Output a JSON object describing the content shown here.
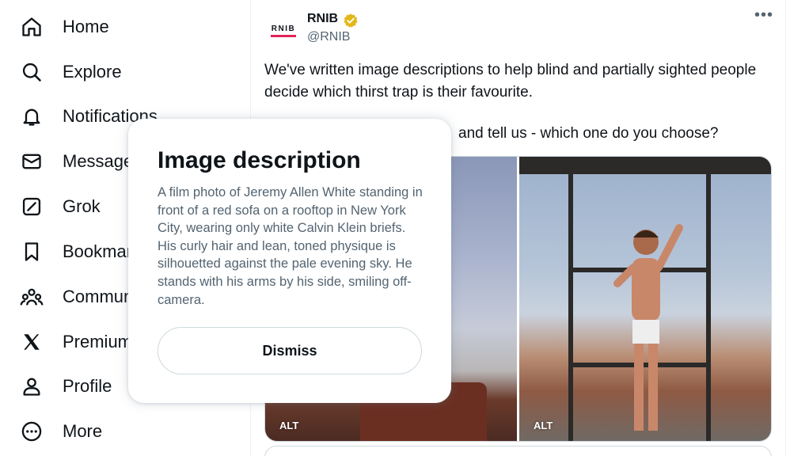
{
  "sidebar": {
    "items": [
      {
        "label": "Home",
        "icon": "home-icon"
      },
      {
        "label": "Explore",
        "icon": "search-icon"
      },
      {
        "label": "Notifications",
        "icon": "bell-icon"
      },
      {
        "label": "Messages",
        "icon": "envelope-icon"
      },
      {
        "label": "Grok",
        "icon": "grok-icon"
      },
      {
        "label": "Bookmarks",
        "icon": "bookmark-icon"
      },
      {
        "label": "Communities",
        "icon": "communities-icon"
      },
      {
        "label": "Premium",
        "icon": "x-logo-icon"
      },
      {
        "label": "Profile",
        "icon": "person-icon"
      },
      {
        "label": "More",
        "icon": "more-circle-icon"
      }
    ]
  },
  "post": {
    "avatar_text": "RNIB",
    "author_name": "RNIB",
    "author_handle": "@RNIB",
    "verified_color": "#e2b719",
    "text_line1": "We've written image descriptions to help blind and partially sighted people decide which thirst trap is their favourite.",
    "text_line2": "and tell us - which one do you choose?",
    "media": {
      "left_alt": "ALT",
      "right_alt": "ALT"
    }
  },
  "modal": {
    "title": "Image description",
    "body": "A film photo of Jeremy Allen White standing in front of a red sofa on a rooftop in New York City, wearing only white Calvin Klein briefs. His curly hair and lean, toned physique is silhouetted against the pale evening sky. He stands with his arms by his side, smiling off-camera.",
    "dismiss_label": "Dismiss"
  },
  "colors": {
    "text": "#0f1419",
    "muted": "#536471",
    "border": "#cfd9de",
    "brand_accent": "#e2245b"
  }
}
